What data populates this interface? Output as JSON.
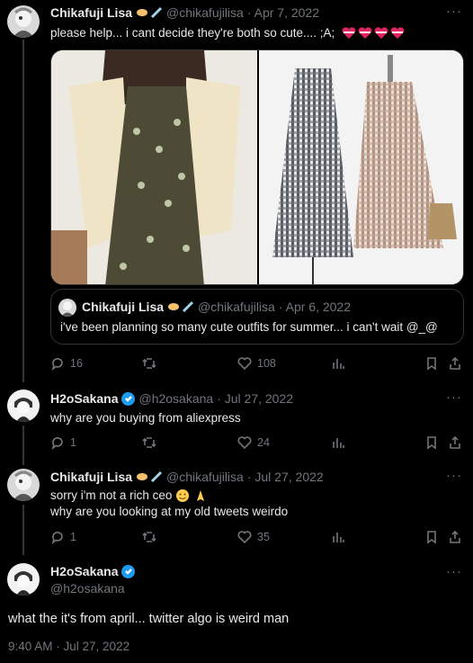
{
  "tweet1": {
    "name": "Chikafuji Lisa",
    "handle": "@chikafujilisa",
    "date": "· Apr 7, 2022",
    "text": "please help... i cant decide they're both so cute.... ;A;",
    "media_left_alt": "person wearing floral dress with cream cardigan",
    "media_right_alt": "two gingham sundresses on mannequins",
    "quote": {
      "name": "Chikafuji Lisa",
      "handle": "@chikafujilisa",
      "date": "· Apr 6, 2022",
      "text": "i've been planning so many cute outfits for summer... i can't wait @_@"
    },
    "replies": "16",
    "retweets": "",
    "likes": "108"
  },
  "tweet2": {
    "name": "H2oSakana",
    "handle": "@h2osakana",
    "date": "· Jul 27, 2022",
    "text": "why are you buying from aliexpress",
    "replies": "1",
    "likes": "24"
  },
  "tweet3": {
    "name": "Chikafuji Lisa",
    "handle": "@chikafujilisa",
    "date": "· Jul 27, 2022",
    "line1": "sorry i'm not a rich ceo",
    "line2": "why are you looking at my old tweets weirdo",
    "replies": "1",
    "likes": "35"
  },
  "tweet4": {
    "name": "H2oSakana",
    "handle": "@h2osakana",
    "text": "what the it's from april... twitter algo is weird man",
    "timestamp": "9:40 AM · Jul 27, 2022"
  },
  "colors": {
    "background": "#000000",
    "text": "#e7e9ea",
    "muted": "#71767b",
    "verified": "#1d9bf0",
    "border": "#2f3336"
  }
}
